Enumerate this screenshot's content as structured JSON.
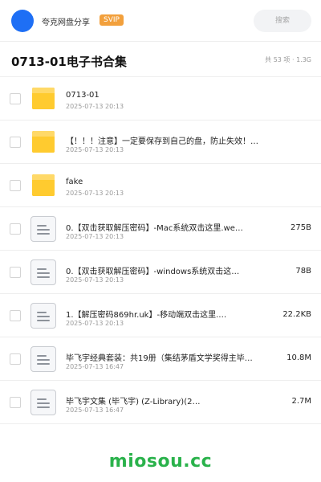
{
  "header": {
    "share_name": "夸克网盘分享",
    "badge": "SVIP",
    "search_placeholder": "搜索"
  },
  "title_bar": {
    "title": "0713-01电子书合集",
    "meta": "共 53 项 · 1.3G"
  },
  "files": [
    {
      "type": "folder",
      "name": "0713-01",
      "date": "2025-07-13 20:13",
      "size": ""
    },
    {
      "type": "folder",
      "name": "【！！！注意】一定要保存到自己的盘，防止失效！！！",
      "date": "2025-07-13 20:13",
      "size": ""
    },
    {
      "type": "folder",
      "name": "fake",
      "date": "2025-07-13 20:13",
      "size": ""
    },
    {
      "type": "file",
      "name": "0.【双击获取解压密码】-Mac系统双击这里.we…",
      "date": "2025-07-13 20:13",
      "size": "275B"
    },
    {
      "type": "file",
      "name": "0.【双击获取解压密码】-windows系统双击这…",
      "date": "2025-07-13 20:13",
      "size": "78B"
    },
    {
      "type": "file",
      "name": "1.【解压密码869hr.uk】-移动端双击这里.…",
      "date": "2025-07-13 20:13",
      "size": "22.2KB"
    },
    {
      "type": "file",
      "name": "毕飞宇经典套装：共19册（集结茅盾文学奖得主毕飞宇…",
      "date": "2025-07-13 16:47",
      "size": "10.8M"
    },
    {
      "type": "file",
      "name": "毕飞宇文集 (毕飞宇) (Z-Library)(2…",
      "date": "2025-07-13 16:47",
      "size": "2.7M"
    }
  ],
  "watermark": "miosou.cc",
  "colors": {
    "avatar": "#1e6ff5",
    "badge": "#f2a03c",
    "folder": "#ffcb2f",
    "watermark": "#2ab24b"
  }
}
